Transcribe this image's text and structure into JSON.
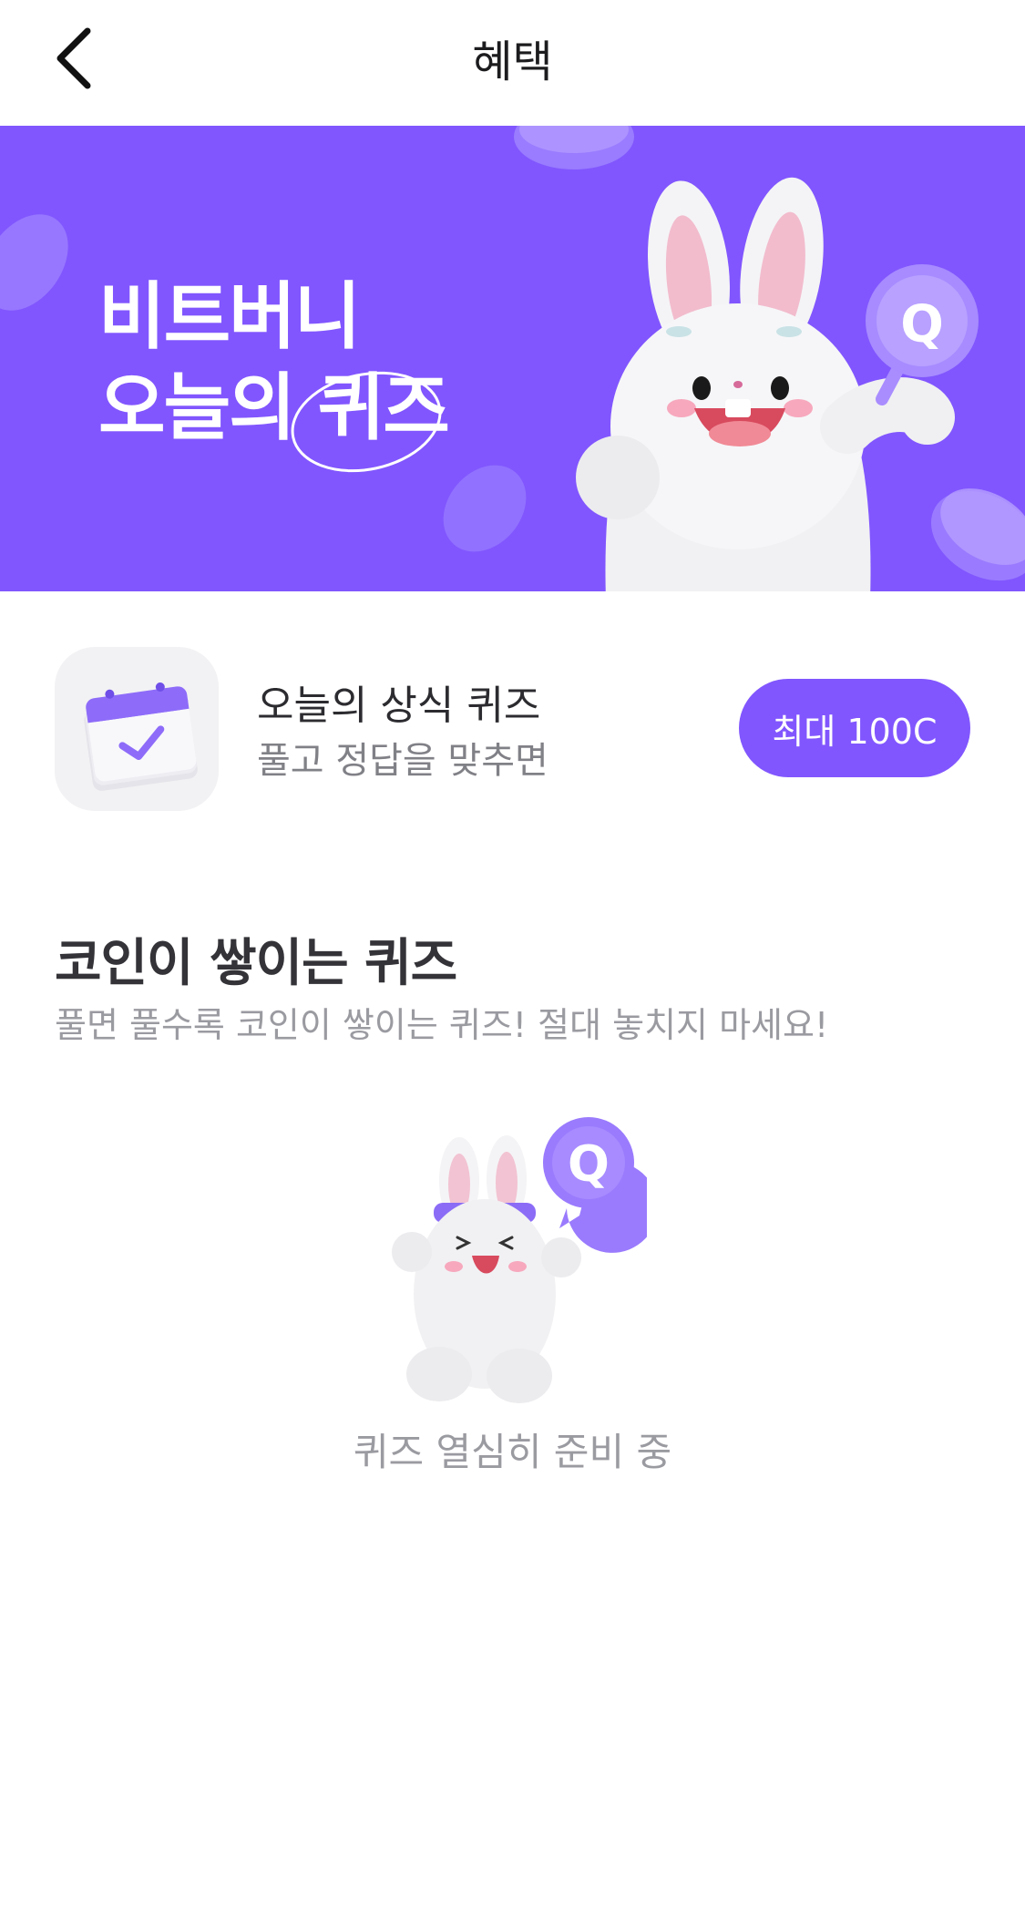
{
  "header": {
    "title": "혜택"
  },
  "banner": {
    "line1": "비트버니",
    "line2_prefix": "오늘의",
    "line2_highlight": "퀴즈",
    "badge_letter": "Q",
    "colors": {
      "background": "#8156fe",
      "coin": "#a58cff"
    }
  },
  "daily_quiz": {
    "icon": "calendar-check-icon",
    "title": "오늘의 상식 퀴즈",
    "subtitle": "풀고 정답을 맞추면",
    "reward_label": "최대 100C"
  },
  "section": {
    "title": "코인이 쌓이는 퀴즈",
    "subtitle": "풀면 풀수록 코인이 쌓이는 퀴즈! 절대 놓치지 마세요!"
  },
  "empty_state": {
    "badge_letter": "Q",
    "message": "퀴즈 열심히 준비 중"
  },
  "colors": {
    "accent": "#8156fe",
    "text_primary": "#2f2f33",
    "text_secondary": "#9a9aa1"
  }
}
